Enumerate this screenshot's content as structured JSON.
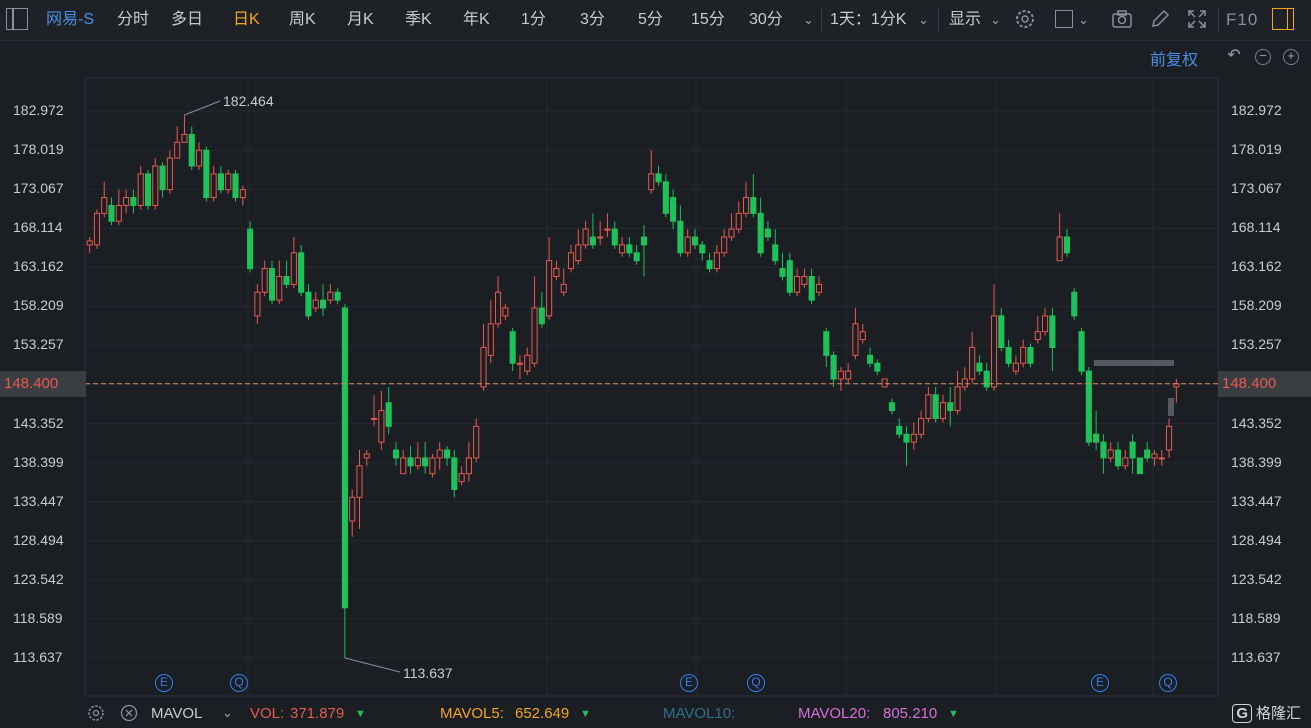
{
  "toolbar": {
    "stock_name": "网易-S",
    "periods": [
      "分时",
      "多日",
      "日K",
      "周K",
      "月K",
      "季K",
      "年K",
      "1分",
      "3分",
      "5分",
      "15分",
      "30分"
    ],
    "active_period": "日K",
    "range_label": "1天：1分K",
    "display_label": "显示",
    "f10_label": "F10"
  },
  "subbar": {
    "adjust_label": "前复权"
  },
  "axis": {
    "ticks": [
      "182.972",
      "178.019",
      "173.067",
      "168.114",
      "163.162",
      "158.209",
      "153.257",
      "148.400",
      "143.352",
      "138.399",
      "133.447",
      "128.494",
      "123.542",
      "118.589",
      "113.637"
    ],
    "current_price": "148.400"
  },
  "annotations": {
    "high": "182.464",
    "low": "113.637"
  },
  "event_markers": [
    "E",
    "Q",
    "E",
    "Q",
    "E",
    "Q"
  ],
  "bottom": {
    "indicator": "MAVOL",
    "vol_label": "VOL:",
    "vol_value": "371.879",
    "mavol5_label": "MAVOL5:",
    "mavol5_value": "652.649",
    "mavol10_label": "MAVOL10:",
    "mavol20_label": "MAVOL20:",
    "mavol20_value": "805.210",
    "logo_text": "格隆汇"
  },
  "colors": {
    "up": "#e85a4f",
    "down": "#1ec25a",
    "accent": "#f5a623",
    "link": "#4a90e2"
  },
  "chart_data": {
    "type": "candlestick",
    "ylim": [
      113.637,
      182.972
    ],
    "high_marker": 182.464,
    "low_marker": 113.637,
    "last_price": 148.4,
    "candles": [
      [
        166,
        166.5,
        165,
        167
      ],
      [
        166,
        170,
        165.5,
        170.5
      ],
      [
        170,
        172,
        169.5,
        174
      ],
      [
        171,
        169,
        168.5,
        172
      ],
      [
        169,
        171,
        168.5,
        173
      ],
      [
        171,
        172,
        170,
        173
      ],
      [
        172,
        171,
        170,
        173
      ],
      [
        171,
        175,
        170.5,
        176
      ],
      [
        175,
        171,
        170.5,
        175.5
      ],
      [
        171,
        176,
        170.5,
        177
      ],
      [
        176,
        173,
        172,
        176.5
      ],
      [
        173,
        177,
        172.5,
        178
      ],
      [
        177,
        179,
        178,
        181
      ],
      [
        179,
        180,
        179,
        182.464
      ],
      [
        180,
        176,
        175.5,
        181
      ],
      [
        176,
        178,
        175.5,
        179
      ],
      [
        178,
        172,
        171.5,
        178.5
      ],
      [
        172,
        175,
        171.5,
        176
      ],
      [
        175,
        173,
        172.5,
        176
      ],
      [
        173,
        175,
        172.5,
        175.5
      ],
      [
        175,
        172,
        171.5,
        175.5
      ],
      [
        172,
        173,
        171,
        173.5
      ],
      [
        168,
        163,
        162.5,
        169
      ],
      [
        157,
        160,
        156,
        161
      ],
      [
        160,
        163,
        159.5,
        164
      ],
      [
        163,
        159,
        158.5,
        164
      ],
      [
        159,
        162,
        158.5,
        164
      ],
      [
        162,
        161,
        160.5,
        164
      ],
      [
        161,
        165,
        160.5,
        167
      ],
      [
        165,
        160,
        159.5,
        166
      ],
      [
        160,
        157,
        156.5,
        161
      ],
      [
        158,
        159,
        157.5,
        160
      ],
      [
        159,
        158,
        157,
        161
      ],
      [
        159,
        160,
        158.5,
        161
      ],
      [
        160,
        159,
        158.5,
        160.5
      ],
      [
        158,
        120,
        113.637,
        158.5
      ],
      [
        131,
        134,
        129,
        135
      ],
      [
        134,
        138,
        130,
        140
      ],
      [
        139,
        139.5,
        138,
        140
      ],
      [
        144,
        144,
        143,
        147
      ],
      [
        141,
        145,
        140,
        147.5
      ],
      [
        146,
        143,
        142,
        148
      ],
      [
        140,
        139,
        138,
        141
      ],
      [
        137,
        139,
        137,
        140
      ],
      [
        139,
        138,
        137,
        140.5
      ],
      [
        138,
        139,
        137.5,
        141
      ],
      [
        139,
        138,
        137,
        141
      ],
      [
        137,
        139,
        136.5,
        139.5
      ],
      [
        139,
        140,
        137.5,
        141
      ],
      [
        140,
        139,
        138,
        140.5
      ],
      [
        139,
        135,
        134,
        140
      ],
      [
        136,
        137,
        135.5,
        138
      ],
      [
        137,
        139,
        136,
        141
      ],
      [
        139,
        143,
        138.5,
        144
      ],
      [
        148,
        153,
        147.5,
        156
      ],
      [
        152,
        156,
        151,
        159
      ],
      [
        156,
        160,
        155.5,
        162
      ],
      [
        157,
        158,
        156.5,
        158.5
      ],
      [
        155,
        151,
        150,
        155.5
      ],
      [
        151,
        151,
        149,
        152
      ],
      [
        150,
        152,
        149.5,
        153
      ],
      [
        151,
        158,
        150.5,
        162
      ],
      [
        158,
        156,
        155.5,
        160
      ],
      [
        157,
        164,
        156.5,
        167
      ],
      [
        162,
        163,
        161.5,
        164
      ],
      [
        160,
        161,
        159.5,
        163
      ],
      [
        163,
        165,
        162.5,
        166
      ],
      [
        164,
        166,
        163.5,
        168
      ],
      [
        166,
        168,
        165.5,
        169
      ],
      [
        167,
        166,
        165.5,
        170
      ],
      [
        167,
        167,
        166,
        169
      ],
      [
        168,
        168,
        167,
        170
      ],
      [
        168,
        166,
        165.5,
        169
      ],
      [
        165,
        166,
        164.5,
        167
      ],
      [
        166,
        165,
        164.5,
        167
      ],
      [
        165,
        164,
        163.5,
        166
      ],
      [
        167,
        166,
        162,
        168.5
      ],
      [
        173,
        175,
        172.5,
        178
      ],
      [
        175,
        174,
        173.5,
        176
      ],
      [
        174,
        170,
        169.5,
        175
      ],
      [
        172,
        169,
        168,
        173
      ],
      [
        169,
        165,
        164.5,
        171
      ],
      [
        165,
        167,
        164.5,
        168
      ],
      [
        167,
        166,
        165.5,
        168
      ],
      [
        166,
        165,
        164,
        166.5
      ],
      [
        164,
        163,
        162.5,
        165
      ],
      [
        163,
        165,
        162.5,
        166
      ],
      [
        165,
        167,
        164.5,
        168
      ],
      [
        167,
        168,
        166.5,
        170
      ],
      [
        168,
        170,
        167.5,
        171.5
      ],
      [
        170,
        172,
        169.5,
        174
      ],
      [
        172,
        170,
        169.5,
        175
      ],
      [
        170,
        165,
        164.5,
        172
      ],
      [
        168,
        167,
        166.5,
        169
      ],
      [
        166,
        164,
        163.5,
        168
      ],
      [
        163,
        162,
        161.5,
        165
      ],
      [
        164,
        160,
        159.5,
        165
      ],
      [
        160,
        162,
        159.5,
        163
      ],
      [
        161,
        162,
        160.5,
        163
      ],
      [
        162,
        159,
        158.5,
        163
      ],
      [
        160,
        161,
        159.5,
        162
      ],
      [
        155,
        152,
        150.5,
        155.5
      ],
      [
        152,
        149,
        148,
        152.5
      ],
      [
        149,
        150,
        147.5,
        150.5
      ],
      [
        149,
        150,
        148.5,
        151
      ],
      [
        152,
        156,
        151.5,
        158
      ],
      [
        154,
        155,
        153.5,
        156
      ],
      [
        152,
        151,
        150.5,
        153
      ],
      [
        151,
        150,
        149.5,
        151.5
      ],
      [
        148,
        149,
        148,
        149
      ],
      [
        146,
        145,
        144.5,
        146.5
      ],
      [
        143,
        142,
        141.5,
        144
      ],
      [
        142,
        141,
        138,
        143
      ],
      [
        141,
        142,
        140,
        143.5
      ],
      [
        142,
        144,
        141.5,
        145
      ],
      [
        144,
        147,
        143.5,
        148
      ],
      [
        147,
        144,
        143.5,
        148
      ],
      [
        144,
        146,
        143.5,
        147
      ],
      [
        146,
        145,
        143,
        148
      ],
      [
        145,
        148,
        144.5,
        150
      ],
      [
        148,
        149,
        147.5,
        150.5
      ],
      [
        149,
        153,
        148.5,
        155
      ],
      [
        151,
        150,
        149.5,
        152
      ],
      [
        150,
        148,
        147.5,
        151
      ],
      [
        148,
        157,
        147.5,
        161
      ],
      [
        157,
        153,
        152.5,
        158
      ],
      [
        153,
        151,
        150.5,
        154
      ],
      [
        150,
        151,
        149.5,
        152
      ],
      [
        151,
        153,
        150.5,
        154
      ],
      [
        153,
        151,
        150.5,
        153.5
      ],
      [
        154,
        155,
        153.5,
        157
      ],
      [
        155,
        157,
        154.5,
        158
      ],
      [
        157,
        153,
        150,
        158
      ],
      [
        164,
        167,
        164,
        170
      ],
      [
        167,
        165,
        164.5,
        168
      ],
      [
        160,
        157,
        156.5,
        160.5
      ],
      [
        155,
        150,
        149.5,
        155.5
      ],
      [
        150,
        141,
        140.5,
        150.5
      ],
      [
        142,
        141,
        140,
        145
      ],
      [
        141,
        139,
        137,
        142
      ],
      [
        139,
        140,
        138.5,
        141
      ],
      [
        140,
        138,
        137.5,
        141
      ],
      [
        138,
        139,
        137.5,
        140
      ],
      [
        141,
        139,
        137,
        142
      ],
      [
        139,
        137,
        137,
        139
      ],
      [
        140,
        139,
        138.5,
        141
      ],
      [
        139,
        139.5,
        138,
        140
      ],
      [
        139,
        139,
        138,
        140
      ],
      [
        140,
        143,
        139,
        144
      ],
      [
        148,
        148.4,
        146,
        149
      ]
    ]
  }
}
